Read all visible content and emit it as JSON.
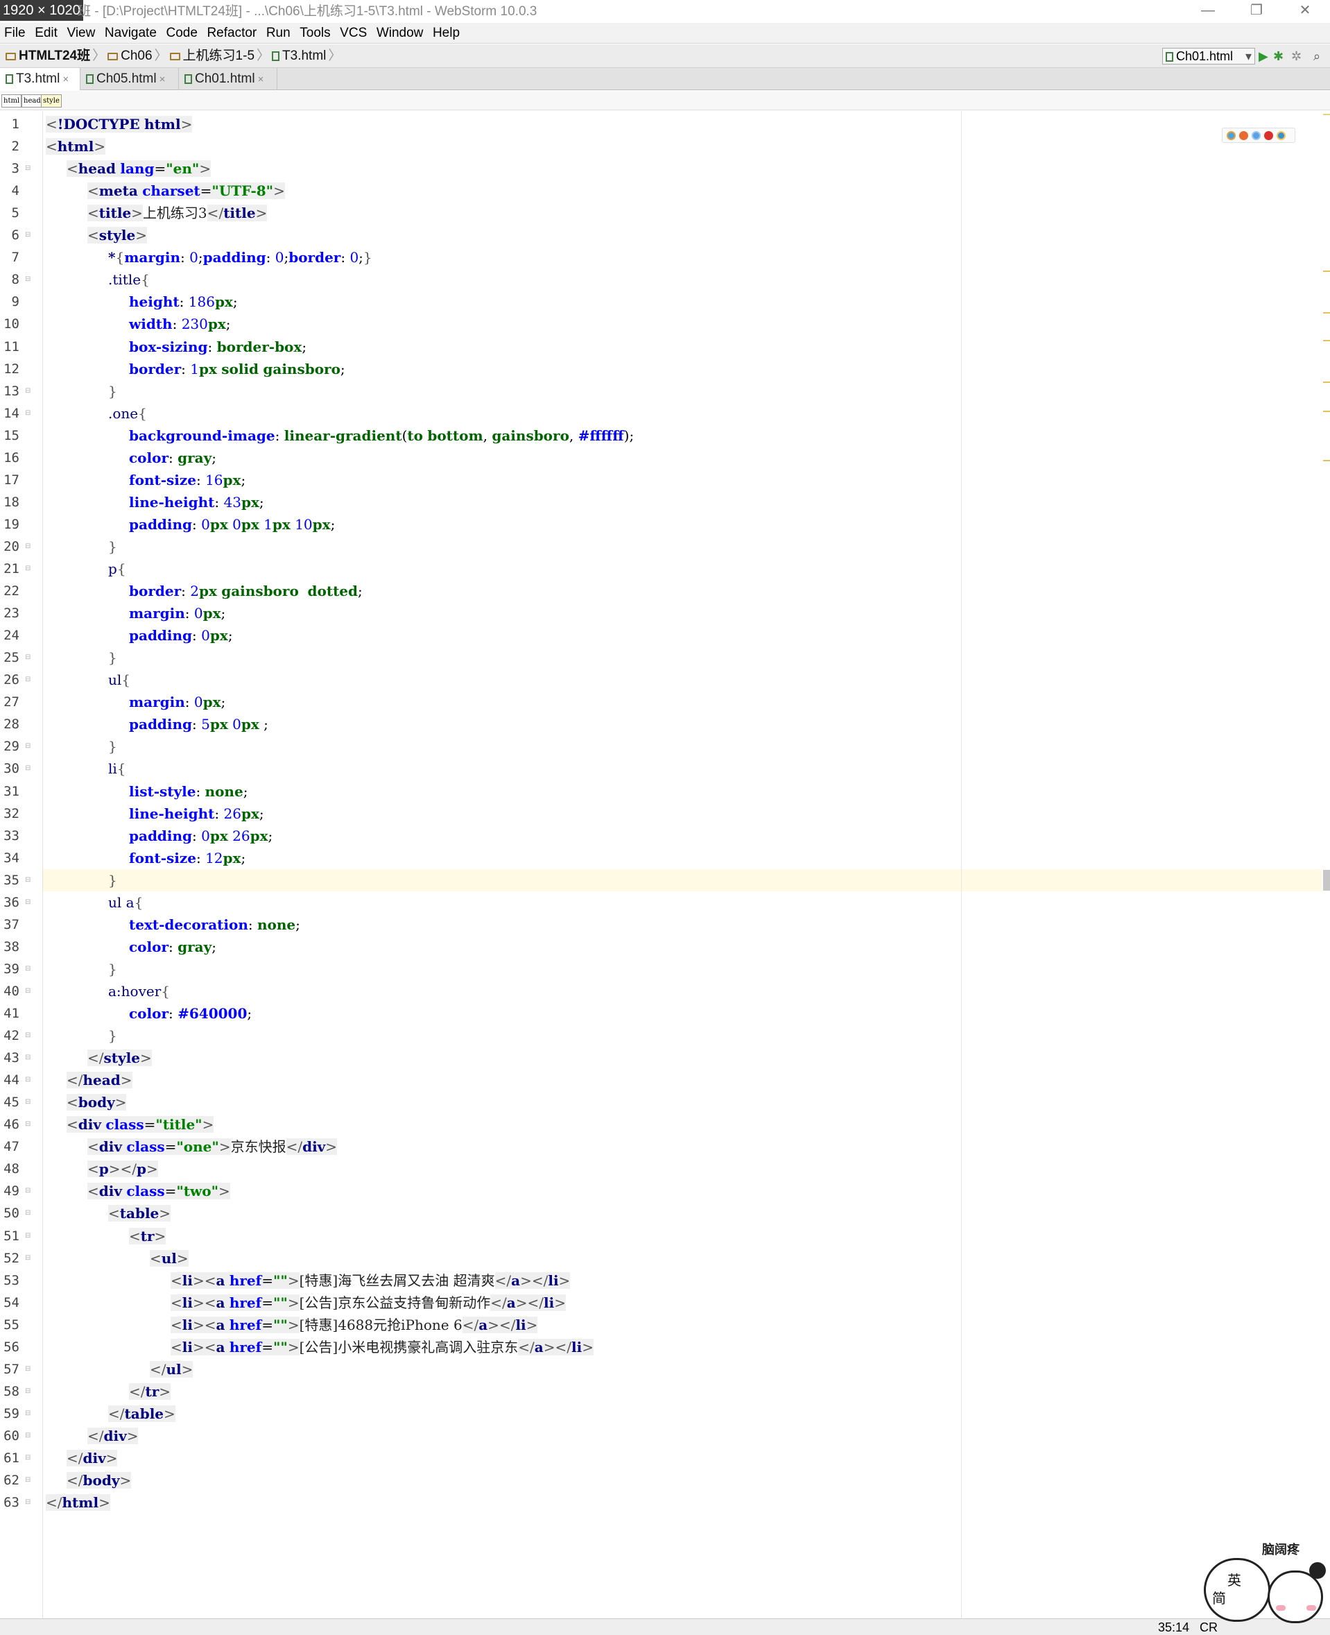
{
  "window": {
    "dimension_badge": "1920 × 1020",
    "title": "班 - [D:\\Project\\HTMLT24班] - ...\\Ch06\\上机练习1-5\\T3.html - WebStorm 10.0.3",
    "minimize": "—",
    "restore": "❐",
    "close": "✕"
  },
  "menu": [
    "File",
    "Edit",
    "View",
    "Navigate",
    "Code",
    "Refactor",
    "Run",
    "Tools",
    "VCS",
    "Window",
    "Help"
  ],
  "breadcrumb": {
    "project": "HTMLT24班",
    "folder1": "Ch06",
    "folder2": "上机练习1-5",
    "file": "T3.html",
    "sep": "〉"
  },
  "run_config": {
    "label": "Ch01.html",
    "caret": "▾",
    "run_glyph": "▶",
    "debug_glyph": "✱",
    "coverage_glyph": "✲",
    "search_glyph": "⌕"
  },
  "tabs": [
    {
      "label": "T3.html",
      "close": "×"
    },
    {
      "label": "Ch05.html",
      "close": "×"
    },
    {
      "label": "Ch01.html",
      "close": "×"
    }
  ],
  "tag_path": [
    "html",
    "head",
    "style"
  ],
  "status": {
    "position": "35:14",
    "encoding": "CR"
  },
  "sticker": {
    "title": "脑阔疼",
    "char1": "英",
    "char2": "简"
  },
  "colors": {
    "accent_green": "#3aa53a",
    "tag_blue": "#000080",
    "attr_blue": "#0000ff",
    "string_green": "#008000",
    "caret_line": "#fffae3"
  },
  "code": {
    "caret_line": 35,
    "lines": [
      {
        "n": "1",
        "d": 0,
        "t": "t",
        "s": "<!DOCTYPE html>"
      },
      {
        "n": "2",
        "d": 0,
        "t": "t",
        "s": "<html>"
      },
      {
        "n": "3",
        "d": 1,
        "t": "t",
        "s": "<head lang=\"en\">"
      },
      {
        "n": "4",
        "d": 2,
        "t": "t",
        "s": "<meta charset=\"UTF-8\">"
      },
      {
        "n": "5",
        "d": 2,
        "t": "t",
        "s": "<title>上机练习3</title>"
      },
      {
        "n": "6",
        "d": 2,
        "t": "t",
        "s": "<style>"
      },
      {
        "n": "7",
        "d": 3,
        "t": "c",
        "s": "*{margin: 0;padding: 0;border: 0;}"
      },
      {
        "n": "8",
        "d": 3,
        "t": "c",
        "s": ".title{"
      },
      {
        "n": "9",
        "d": 4,
        "t": "c",
        "s": "height: 186px;"
      },
      {
        "n": "10",
        "d": 4,
        "t": "c",
        "s": "width: 230px;"
      },
      {
        "n": "11",
        "d": 4,
        "t": "c",
        "s": "box-sizing: border-box;"
      },
      {
        "n": "12",
        "d": 4,
        "t": "c",
        "s": "border: 1px solid gainsboro;"
      },
      {
        "n": "13",
        "d": 3,
        "t": "c",
        "s": "}"
      },
      {
        "n": "14",
        "d": 3,
        "t": "c",
        "s": ".one{"
      },
      {
        "n": "15",
        "d": 4,
        "t": "c",
        "s": "background-image: linear-gradient(to bottom, gainsboro, #ffffff);"
      },
      {
        "n": "16",
        "d": 4,
        "t": "c",
        "s": "color: gray;"
      },
      {
        "n": "17",
        "d": 4,
        "t": "c",
        "s": "font-size: 16px;"
      },
      {
        "n": "18",
        "d": 4,
        "t": "c",
        "s": "line-height: 43px;"
      },
      {
        "n": "19",
        "d": 4,
        "t": "c",
        "s": "padding: 0px 0px 1px 10px;"
      },
      {
        "n": "20",
        "d": 3,
        "t": "c",
        "s": "}"
      },
      {
        "n": "21",
        "d": 3,
        "t": "c",
        "s": "p{"
      },
      {
        "n": "22",
        "d": 4,
        "t": "c",
        "s": "border: 2px gainsboro  dotted;"
      },
      {
        "n": "23",
        "d": 4,
        "t": "c",
        "s": "margin: 0px;"
      },
      {
        "n": "24",
        "d": 4,
        "t": "c",
        "s": "padding: 0px;"
      },
      {
        "n": "25",
        "d": 3,
        "t": "c",
        "s": "}"
      },
      {
        "n": "26",
        "d": 3,
        "t": "c",
        "s": "ul{"
      },
      {
        "n": "27",
        "d": 4,
        "t": "c",
        "s": "margin: 0px;"
      },
      {
        "n": "28",
        "d": 4,
        "t": "c",
        "s": "padding: 5px 0px ;"
      },
      {
        "n": "29",
        "d": 3,
        "t": "c",
        "s": "}"
      },
      {
        "n": "30",
        "d": 3,
        "t": "c",
        "s": "li{"
      },
      {
        "n": "31",
        "d": 4,
        "t": "c",
        "s": "list-style: none;"
      },
      {
        "n": "32",
        "d": 4,
        "t": "c",
        "s": "line-height: 26px;"
      },
      {
        "n": "33",
        "d": 4,
        "t": "c",
        "s": "padding: 0px 26px;"
      },
      {
        "n": "34",
        "d": 4,
        "t": "c",
        "s": "font-size: 12px;"
      },
      {
        "n": "35",
        "d": 3,
        "t": "c",
        "s": "}"
      },
      {
        "n": "36",
        "d": 3,
        "t": "c",
        "s": "ul a{"
      },
      {
        "n": "37",
        "d": 4,
        "t": "c",
        "s": "text-decoration: none;"
      },
      {
        "n": "38",
        "d": 4,
        "t": "c",
        "s": "color: gray;"
      },
      {
        "n": "39",
        "d": 3,
        "t": "c",
        "s": "}"
      },
      {
        "n": "40",
        "d": 3,
        "t": "c",
        "s": "a:hover{"
      },
      {
        "n": "41",
        "d": 4,
        "t": "c",
        "s": "color: #640000;"
      },
      {
        "n": "42",
        "d": 3,
        "t": "c",
        "s": "}"
      },
      {
        "n": "43",
        "d": 2,
        "t": "t",
        "s": "</style>"
      },
      {
        "n": "44",
        "d": 1,
        "t": "t",
        "s": "</head>"
      },
      {
        "n": "45",
        "d": 1,
        "t": "t",
        "s": "<body>"
      },
      {
        "n": "46",
        "d": 1,
        "t": "t",
        "s": "<div class=\"title\">"
      },
      {
        "n": "47",
        "d": 2,
        "t": "t",
        "s": "<div class=\"one\">京东快报</div>"
      },
      {
        "n": "48",
        "d": 2,
        "t": "t",
        "s": "<p></p>"
      },
      {
        "n": "49",
        "d": 2,
        "t": "t",
        "s": "<div class=\"two\">"
      },
      {
        "n": "50",
        "d": 3,
        "t": "t",
        "s": "<table>"
      },
      {
        "n": "51",
        "d": 4,
        "t": "t",
        "s": "<tr>"
      },
      {
        "n": "52",
        "d": 5,
        "t": "t",
        "s": "<ul>"
      },
      {
        "n": "53",
        "d": 6,
        "t": "t",
        "s": "<li><a href=\"\">[特惠]海飞丝去屑又去油 超清爽</a></li>"
      },
      {
        "n": "54",
        "d": 6,
        "t": "t",
        "s": "<li><a href=\"\">[公告]京东公益支持鲁甸新动作</a></li>"
      },
      {
        "n": "55",
        "d": 6,
        "t": "t",
        "s": "<li><a href=\"\">[特惠]4688元抢iPhone 6</a></li>"
      },
      {
        "n": "56",
        "d": 6,
        "t": "t",
        "s": "<li><a href=\"\">[公告]小米电视携豪礼高调入驻京东</a></li>"
      },
      {
        "n": "57",
        "d": 5,
        "t": "t",
        "s": "</ul>"
      },
      {
        "n": "58",
        "d": 4,
        "t": "t",
        "s": "</tr>"
      },
      {
        "n": "59",
        "d": 3,
        "t": "t",
        "s": "</table>"
      },
      {
        "n": "60",
        "d": 2,
        "t": "t",
        "s": "</div>"
      },
      {
        "n": "61",
        "d": 1,
        "t": "t",
        "s": "</div>"
      },
      {
        "n": "62",
        "d": 1,
        "t": "t",
        "s": "</body>"
      },
      {
        "n": "63",
        "d": 0,
        "t": "t",
        "s": "</html>"
      }
    ]
  }
}
